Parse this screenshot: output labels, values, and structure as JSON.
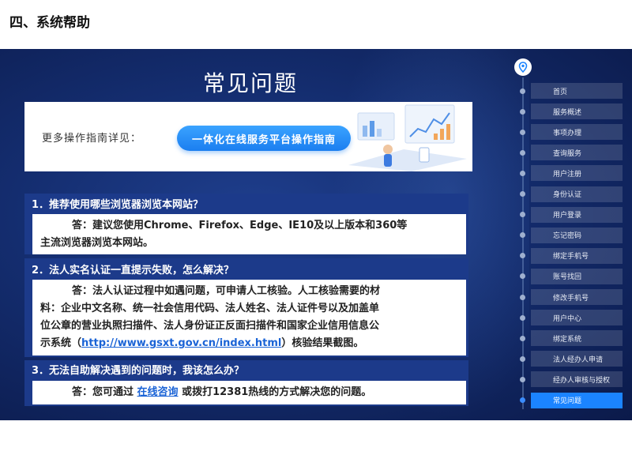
{
  "doc_heading": "四、系统帮助",
  "faq_title": "常见问题",
  "guide": {
    "label": "更多操作指南详见：",
    "button": "一体化在线服务平台操作指南"
  },
  "faqs": [
    {
      "question": "1．推荐使用哪些浏览器浏览本网站？",
      "answer_lines": [
        "答：建议您使用Chrome、Firefox、Edge、IE10及以上版本和360等",
        "主流浏览器浏览本网站。"
      ]
    },
    {
      "question": "2．法人实名认证一直提示失败，怎么解决？",
      "answer_lines": [
        "答：法人认证过程中如遇问题，可申请人工核验。人工核验需要的材",
        "料：企业中文名称、统一社会信用代码、法人姓名、法人证件号以及加盖单",
        "位公章的营业执照扫描件、法人身份证正反面扫描件和国家企业信用信息公",
        "示系统（"
      ],
      "answer_link": "http://www.gsxt.gov.cn/index.html",
      "answer_tail": "）核验结果截图。"
    },
    {
      "question": "3．无法自助解决遇到的问题时，我该怎么办？",
      "answer_prefix": "答：您可通过 ",
      "answer_link": "在线咨询",
      "answer_suffix": " 或拨打12381热线的方式解决您的问题。"
    }
  ],
  "nav": {
    "items": [
      "首页",
      "服务概述",
      "事项办理",
      "查询服务",
      "用户注册",
      "身份认证",
      "用户登录",
      "忘记密码",
      "绑定手机号",
      "账号找回",
      "修改手机号",
      "用户中心",
      "绑定系统",
      "法人经办人申请",
      "经办人审核与授权",
      "常见问题"
    ],
    "active_index": 15
  }
}
